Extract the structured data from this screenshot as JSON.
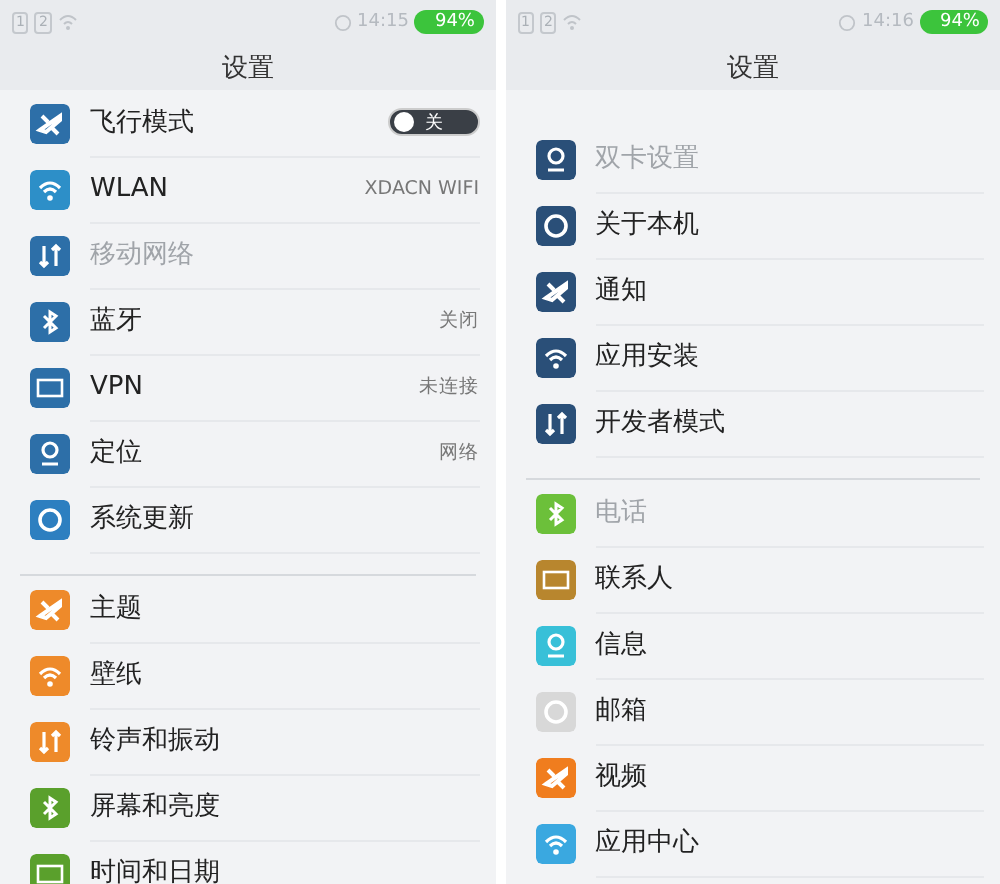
{
  "panels": [
    {
      "status": {
        "sim_slots": [
          "1",
          "2"
        ],
        "time": "14:15",
        "battery": "94%"
      },
      "title": "设置",
      "groups": [
        [
          {
            "kind": "toggle",
            "label": "飞行模式",
            "color": "#2d6fa8",
            "disabled": false,
            "toggle": {
              "on": false,
              "text": "关"
            }
          },
          {
            "kind": "link",
            "label": "WLAN",
            "color": "#2d8fc8",
            "disabled": false,
            "value": "XDACN WIFI"
          },
          {
            "kind": "link",
            "label": "移动网络",
            "color": "#2d6fa8",
            "disabled": true
          },
          {
            "kind": "link",
            "label": "蓝牙",
            "color": "#2d6fa8",
            "disabled": false,
            "value": "关闭"
          },
          {
            "kind": "link",
            "label": "VPN",
            "color": "#2d6fa8",
            "disabled": false,
            "value": "未连接"
          },
          {
            "kind": "link",
            "label": "定位",
            "color": "#2d6fa8",
            "disabled": false,
            "value": "网络"
          },
          {
            "kind": "link",
            "label": "系统更新",
            "color": "#2d7fc0",
            "disabled": false
          }
        ],
        [
          {
            "kind": "link",
            "label": "主题",
            "color": "#ee8a2a",
            "disabled": false
          },
          {
            "kind": "link",
            "label": "壁纸",
            "color": "#ee8a2a",
            "disabled": false
          },
          {
            "kind": "link",
            "label": "铃声和振动",
            "color": "#ee8a2a",
            "disabled": false
          },
          {
            "kind": "link",
            "label": "屏幕和亮度",
            "color": "#5aa02c",
            "disabled": false
          },
          {
            "kind": "link",
            "label": "时间和日期",
            "color": "#5aa02c",
            "disabled": false
          }
        ]
      ]
    },
    {
      "status": {
        "sim_slots": [
          "1",
          "2"
        ],
        "time": "14:16",
        "battery": "94%"
      },
      "title": "设置",
      "groups": [
        [
          {
            "kind": "link",
            "label": "双卡设置",
            "color": "#2a4f78",
            "disabled": true
          },
          {
            "kind": "link",
            "label": "关于本机",
            "color": "#2a4f78",
            "disabled": false
          },
          {
            "kind": "link",
            "label": "通知",
            "color": "#2a4f78",
            "disabled": false
          },
          {
            "kind": "link",
            "label": "应用安装",
            "color": "#2a4f78",
            "disabled": false
          },
          {
            "kind": "link",
            "label": "开发者模式",
            "color": "#2a4f78",
            "disabled": false
          }
        ],
        [
          {
            "kind": "link",
            "label": "电话",
            "color": "#6cc03a",
            "disabled": true
          },
          {
            "kind": "link",
            "label": "联系人",
            "color": "#b8862e",
            "disabled": false
          },
          {
            "kind": "link",
            "label": "信息",
            "color": "#38c0d8",
            "disabled": false
          },
          {
            "kind": "link",
            "label": "邮箱",
            "color": "#d8d8d8",
            "disabled": false
          },
          {
            "kind": "link",
            "label": "视频",
            "color": "#f07d1e",
            "disabled": false
          },
          {
            "kind": "link",
            "label": "应用中心",
            "color": "#3aa8e0",
            "disabled": false
          }
        ]
      ]
    }
  ]
}
